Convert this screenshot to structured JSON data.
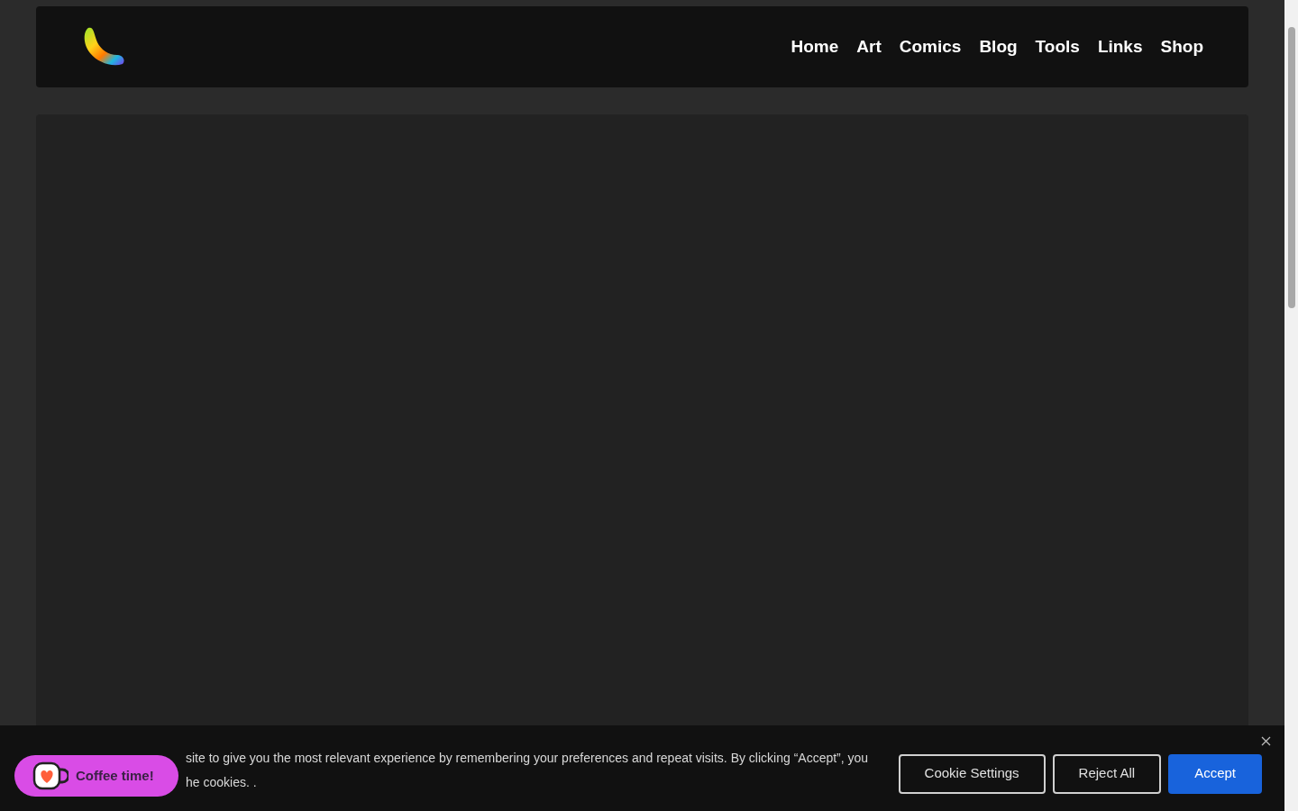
{
  "nav": {
    "items": [
      {
        "label": "Home"
      },
      {
        "label": "Art"
      },
      {
        "label": "Comics"
      },
      {
        "label": "Blog"
      },
      {
        "label": "Tools"
      },
      {
        "label": "Links"
      },
      {
        "label": "Shop"
      }
    ]
  },
  "cookie_banner": {
    "lines": [
      "site to give you the most relevant experience by remembering your preferences and repeat visits. By clicking “Accept”, you",
      "he cookies. ."
    ],
    "buttons": [
      {
        "label": "Cookie Settings",
        "kind": "outline"
      },
      {
        "label": "Reject All",
        "kind": "outline"
      },
      {
        "label": "Accept",
        "kind": "primary"
      }
    ]
  },
  "coffee_button": {
    "label": "Coffee time!"
  }
}
